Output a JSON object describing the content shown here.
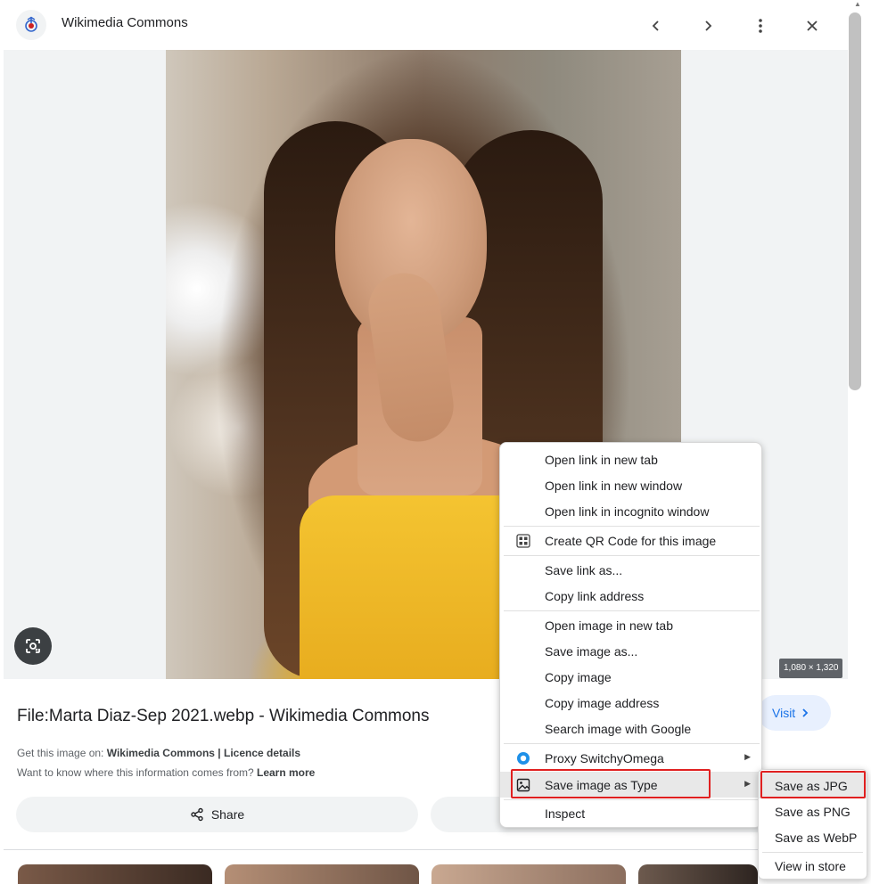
{
  "header": {
    "site_name": "Wikimedia Commons",
    "icons": [
      "wikimedia-logo-icon",
      "chevron-left-icon",
      "chevron-right-icon",
      "more-vert-icon",
      "close-icon"
    ]
  },
  "image": {
    "dimensions": "1,080 × 1,320"
  },
  "info": {
    "title": "File:Marta Diaz-Sep 2021.webp - Wikimedia Commons",
    "visit_label": "Visit",
    "get_prefix": "Get this image on: ",
    "get_source": "Wikimedia Commons",
    "get_sep": " | ",
    "licence": "Licence details",
    "want_prefix": "Want to know where this information comes from? ",
    "learn_more": "Learn more",
    "share_label": "Share"
  },
  "context_menu": {
    "items": [
      {
        "label": "Open link in new tab"
      },
      {
        "label": "Open link in new window"
      },
      {
        "label": "Open link in incognito window"
      },
      {
        "label": "Create QR Code for this image",
        "icon": "qr-code-icon"
      },
      {
        "label": "Save link as..."
      },
      {
        "label": "Copy link address"
      },
      {
        "label": "Open image in new tab"
      },
      {
        "label": "Save image as..."
      },
      {
        "label": "Copy image"
      },
      {
        "label": "Copy image address"
      },
      {
        "label": "Search image with Google"
      },
      {
        "label": "Proxy SwitchyOmega",
        "icon": "proxy-switchyomega-icon",
        "has_submenu": true
      },
      {
        "label": "Save image as Type",
        "icon": "image-icon",
        "has_submenu": true,
        "highlighted": true
      },
      {
        "label": "Inspect"
      }
    ]
  },
  "submenu": {
    "items": [
      {
        "label": "Save as JPG",
        "highlighted": true
      },
      {
        "label": "Save as PNG"
      },
      {
        "label": "Save as WebP"
      },
      {
        "label": "View in store"
      }
    ]
  },
  "colors": {
    "highlight": "#e02020",
    "accent": "#1a73e8",
    "shirt": "#f4c431"
  }
}
